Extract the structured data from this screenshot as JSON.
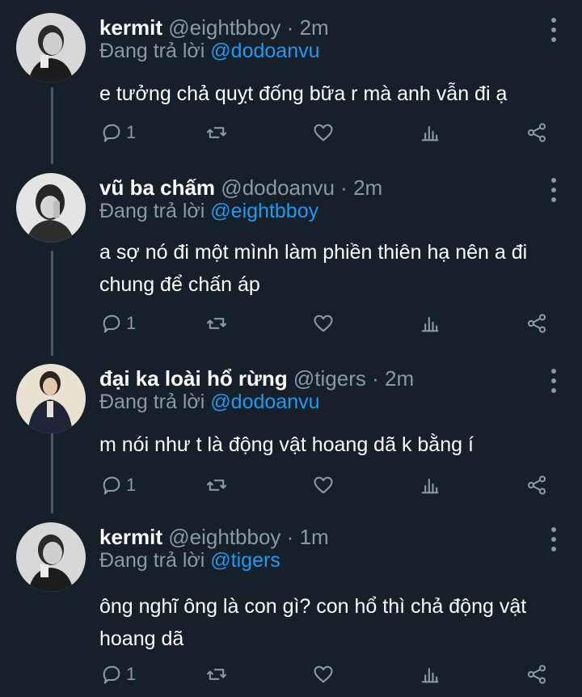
{
  "tweets": [
    {
      "name": "kermit",
      "handle": "@eightbboy",
      "separator": "·",
      "time": "2m",
      "reply_prefix": "Đang trả lời",
      "reply_to": "@dodoanvu",
      "text": "e tưởng chả quỵt đống bữa r mà anh vẫn đi ạ",
      "reply_count": "1"
    },
    {
      "name": "vũ ba chấm",
      "handle": "@dodoanvu",
      "separator": "·",
      "time": "2m",
      "reply_prefix": "Đang trả lời",
      "reply_to": "@eightbboy",
      "text": "a sợ nó đi một mình làm phiền thiên hạ nên a đi chung để chấn áp",
      "reply_count": "1"
    },
    {
      "name": "đại ka loài hổ rừng",
      "handle": "@tigers",
      "separator": "·",
      "time": "2m",
      "reply_prefix": "Đang trả lời",
      "reply_to": "@dodoanvu",
      "text": "m nói như t là động vật hoang dã k bằng í",
      "reply_count": "1"
    },
    {
      "name": "kermit",
      "handle": "@eightbboy",
      "separator": "·",
      "time": "1m",
      "reply_prefix": "Đang trả lời",
      "reply_to": "@tigers",
      "text": "ông nghĩ ông là con gì? con hổ thì chả động vật hoang dã",
      "reply_count": "1"
    }
  ],
  "colors": {
    "background": "#15202b",
    "secondary_text": "#8b98a5",
    "link": "#1d9bf0"
  },
  "icons": [
    "comment-icon",
    "retweet-icon",
    "like-icon",
    "analytics-icon",
    "share-icon",
    "more-options-icon"
  ]
}
